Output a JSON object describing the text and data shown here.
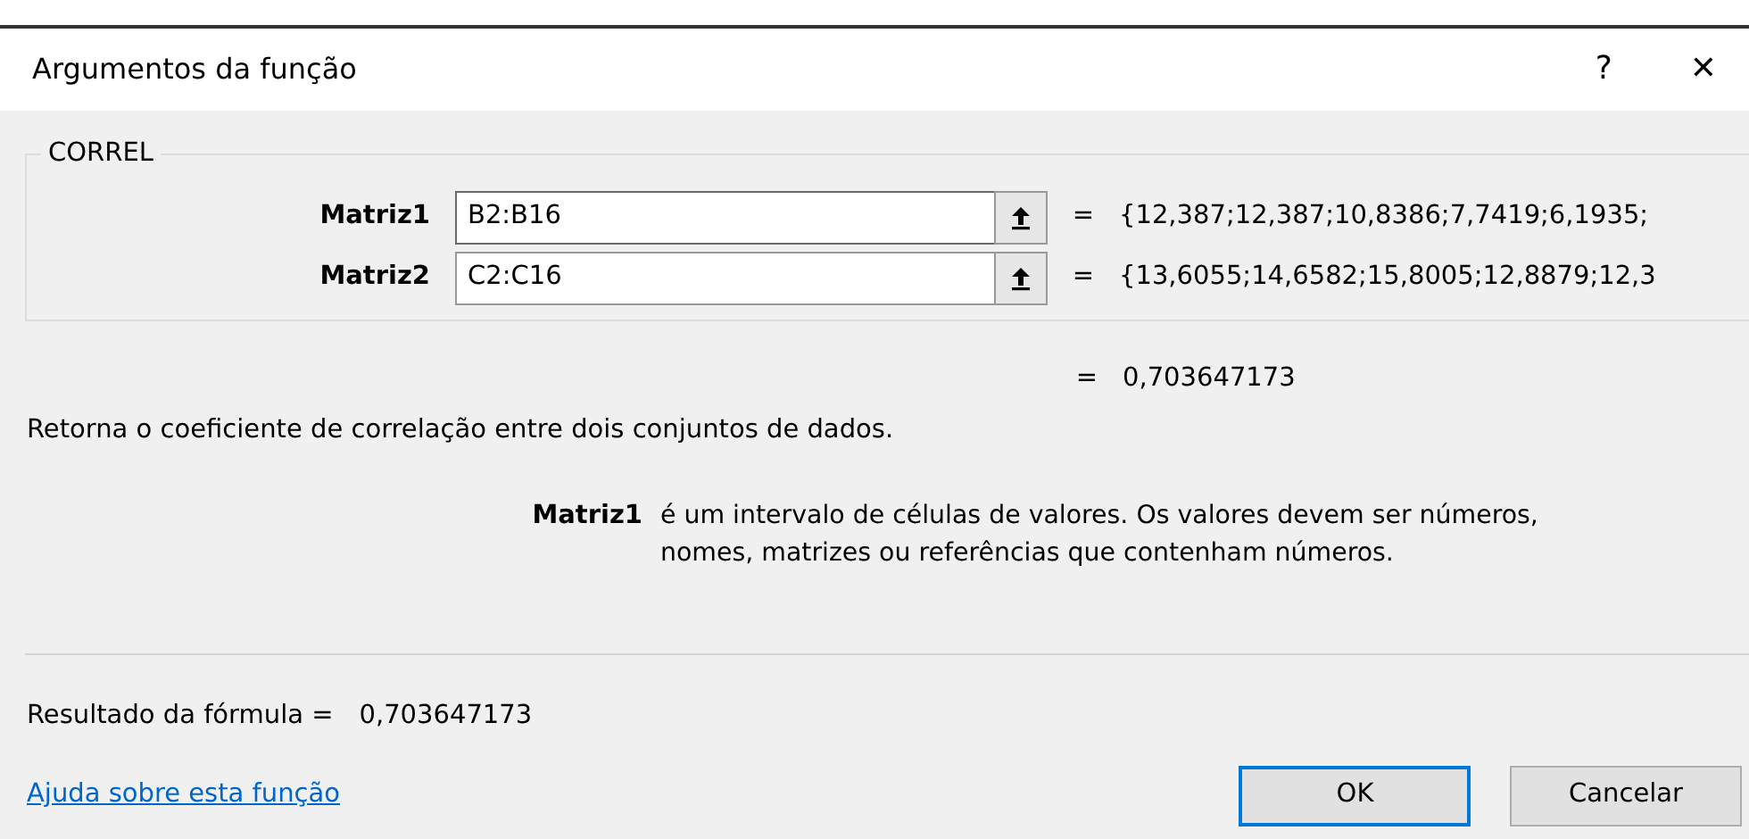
{
  "window": {
    "title": "Argumentos da função",
    "help": "?",
    "close": "✕"
  },
  "function_name": "CORREL",
  "arguments": [
    {
      "label": "Matriz1",
      "value": "B2:B16",
      "focused": true,
      "equals": "=",
      "preview": "{12,387;12,387;10,8386;7,7419;6,1935;"
    },
    {
      "label": "Matriz2",
      "value": "C2:C16",
      "focused": false,
      "equals": "=",
      "preview": "{13,6055;14,6582;15,8005;12,8879;12,3"
    }
  ],
  "result": {
    "equals": "=",
    "value": "0,703647173"
  },
  "description": "Retorna o coeficiente de correlação entre dois conjuntos de dados.",
  "argument_help": {
    "name": "Matriz1",
    "text": "é um intervalo de células de valores. Os valores devem ser números, nomes, matrizes ou referências que contenham números."
  },
  "formula_result": {
    "label": "Resultado da fórmula =",
    "value": "0,703647173"
  },
  "help_link": "Ajuda sobre esta função",
  "buttons": [
    {
      "label": "OK",
      "default": true
    },
    {
      "label": "Cancelar",
      "default": false
    }
  ]
}
